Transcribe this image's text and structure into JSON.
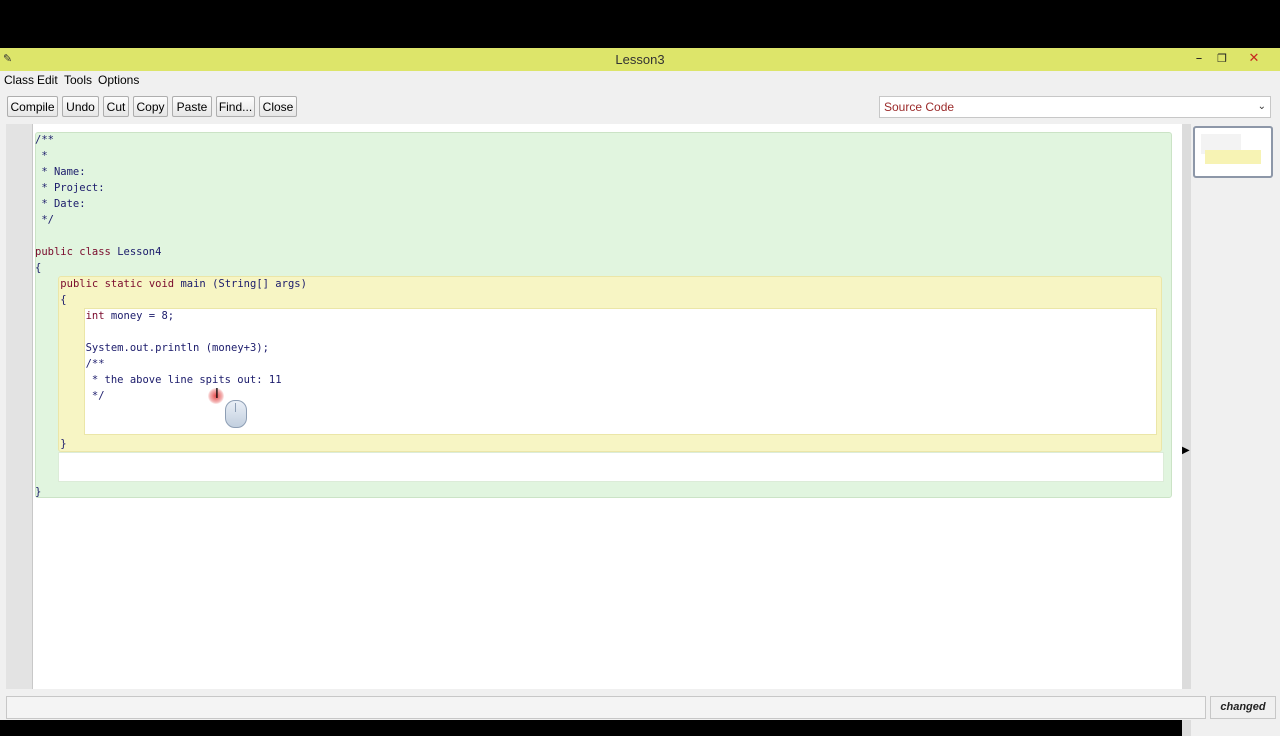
{
  "window": {
    "title": "Lesson3",
    "minimize": "–",
    "maximize": "❐",
    "close": "✕"
  },
  "menu": [
    "Class",
    "Edit",
    "Tools",
    "Options"
  ],
  "toolbar": {
    "compile": "Compile",
    "undo": "Undo",
    "cut": "Cut",
    "copy": "Copy",
    "paste": "Paste",
    "find": "Find...",
    "close": "Close",
    "view_selector": "Source Code"
  },
  "code": {
    "lines": [
      "/**",
      " *",
      " * Name:",
      " * Project:",
      " * Date:",
      " */",
      "",
      "public class Lesson4",
      "{",
      "    public static void main (String[] args)",
      "    {",
      "        int money = 8;",
      "",
      "        System.out.println (money+3);",
      "        /**",
      "         * the above line spits out: 11",
      "         */",
      "",
      "",
      "    }",
      "",
      "",
      "}"
    ]
  },
  "status": {
    "message": "",
    "state": "changed"
  },
  "colors": {
    "titlebar": "#dde56a",
    "class_scope": "#e1f5df",
    "method_scope": "#f7f5c4",
    "keyword": "#7a0a2c",
    "text": "#1b1b6b"
  }
}
